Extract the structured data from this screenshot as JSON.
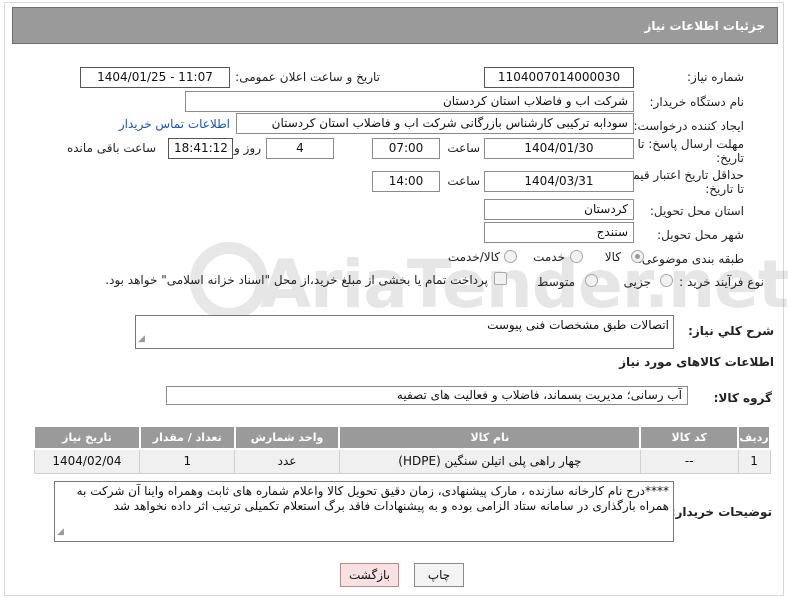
{
  "page": {
    "title": "جزئیات اطلاعات نیاز"
  },
  "form": {
    "need_number": {
      "label": "شماره نیاز:",
      "value": "1104007014000030"
    },
    "announce_datetime": {
      "label": "تاریخ و ساعت اعلان عمومی:",
      "value": "1404/01/25 - 11:07"
    },
    "buyer_org": {
      "label": "نام دستگاه خریدار:",
      "value": "شرکت اب و فاضلاب استان کردستان"
    },
    "requester": {
      "label": "ایجاد کننده درخواست:",
      "value": "سودابه ترکیبی کارشناس بازرگانی شرکت اب و فاضلاب استان کردستان",
      "contact_link": "اطلاعات تماس خریدار"
    },
    "reply_deadline": {
      "label_line1": "مهلت ارسال پاسخ: تا",
      "label_line2": "تاریخ:",
      "date": "1404/01/30",
      "time_label": "ساعت",
      "time": "07:00",
      "days": "4",
      "days_label": "روز و",
      "remaining": "18:41:12",
      "remaining_label": "ساعت باقی مانده"
    },
    "price_validity": {
      "label_line1": "حداقل تاریخ اعتبار قیمت:",
      "label_line2": "تا تاریخ:",
      "date": "1404/03/31",
      "time_label": "ساعت",
      "time": "14:00"
    },
    "delivery_province": {
      "label": "استان محل تحویل:",
      "value": "کردستان"
    },
    "delivery_city": {
      "label": "شهر محل تحویل:",
      "value": "سنندج"
    },
    "category": {
      "label": "طبقه بندی موضوعی:",
      "options": [
        "کالا",
        "خدمت",
        "کالا/خدمت"
      ],
      "selected": "کالا"
    },
    "purchase_type": {
      "label": "نوع فرآیند خرید :",
      "options": [
        "جزیی",
        "متوسط"
      ],
      "payment_note": "پرداخت تمام یا بخشی از مبلغ خرید،از محل \"اسناد خزانه اسلامی\" خواهد بود."
    }
  },
  "summary": {
    "label": "شرح کلي نياز:",
    "value": "اتصالات طبق مشخصات فنی پیوست"
  },
  "goods_section": {
    "title": "اطلاعات کالاهای مورد نیاز",
    "group_label": "گروه کالا:",
    "group_value": "آب رسانی؛ مدیریت پسماند، فاضلاب و فعالیت های تصفیه",
    "columns": [
      "ردیف",
      "کد کالا",
      "نام کالا",
      "واحد شمارش",
      "تعداد / مقدار",
      "تاریخ نیاز"
    ],
    "rows": [
      {
        "row": "1",
        "code": "--",
        "name": "چهار راهی پلی اتیلن سنگین (HDPE)",
        "unit": "عدد",
        "qty": "1",
        "date": "1404/02/04"
      }
    ]
  },
  "buyer_notes": {
    "label": "توضیحات خریدار:",
    "text": "****درج نام کارخانه سازنده ، مارک پیشنهادی، زمان دقیق تحویل کالا واعلام شماره های ثابت وهمراه واینا آن شرکت به همراه بارگذاری در سامانه ستاد الزامی بوده و به پیشنهادات فاقد برگ استعلام تکمیلی ترتیب اثر داده نخواهد شد"
  },
  "buttons": {
    "print": "چاپ",
    "back": "بازگشت"
  },
  "watermark": {
    "text": "AriaTender.net"
  }
}
